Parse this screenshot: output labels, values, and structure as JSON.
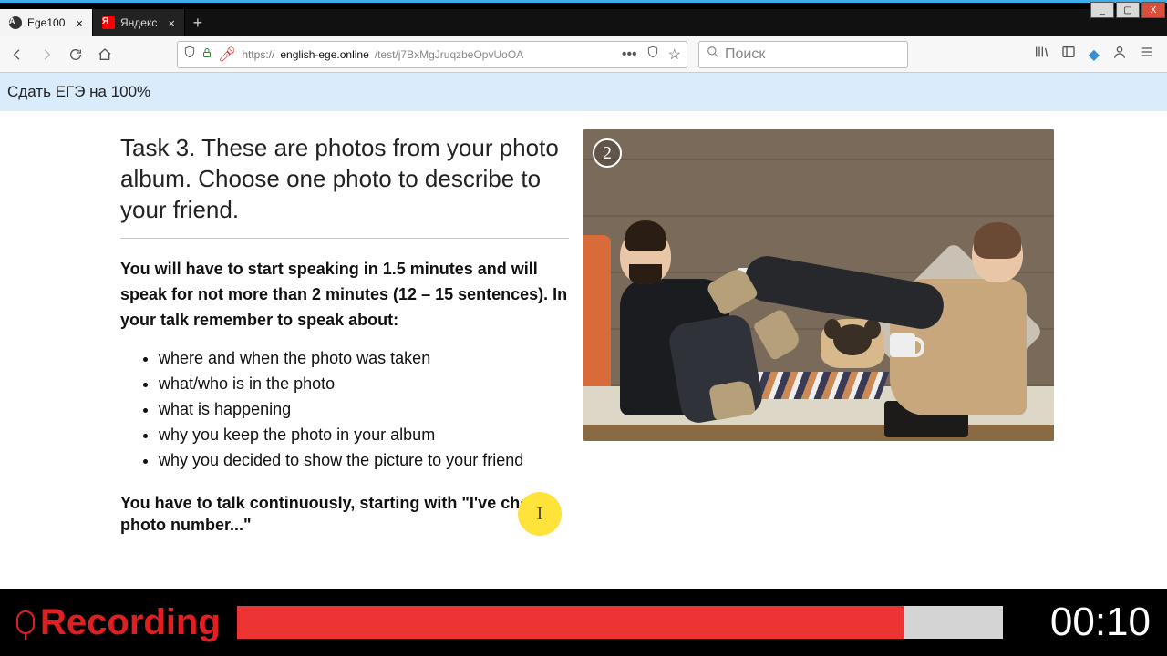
{
  "window": {
    "tabs": [
      {
        "label": "Ege100",
        "favicon": "a"
      },
      {
        "label": "Яндекс",
        "favicon": "y"
      }
    ],
    "newtab": "+",
    "controls": {
      "min": "_",
      "max": "▢",
      "close": "X"
    }
  },
  "nav": {
    "url_proto": "https://",
    "url_host": "english-ege.online",
    "url_path": "/test/j7BxMgJruqzbeOpvUoOA",
    "search_placeholder": "Поиск"
  },
  "banner": {
    "text": "Сдать ЕГЭ на 100%"
  },
  "task": {
    "heading": "Task 3. These are photos from your photo album. Choose one photo to describe to your friend.",
    "instructions": "You will have to start speaking in 1.5 minutes and will speak for not more than 2 minutes (12 – 15 sentences). In your talk remember to speak about:",
    "points": [
      "where and when the photo was taken",
      "what/who is in the photo",
      "what is happening",
      "why you keep the photo in your album",
      "why you decided to show the picture to your friend"
    ],
    "closing": "You have to talk continuously, starting with \"I've chosen photo number...\"",
    "photo_badge": "2"
  },
  "recorder": {
    "label": "Recording",
    "progress_pct": 87,
    "timer": "00:10"
  },
  "cursor_glyph": "I"
}
